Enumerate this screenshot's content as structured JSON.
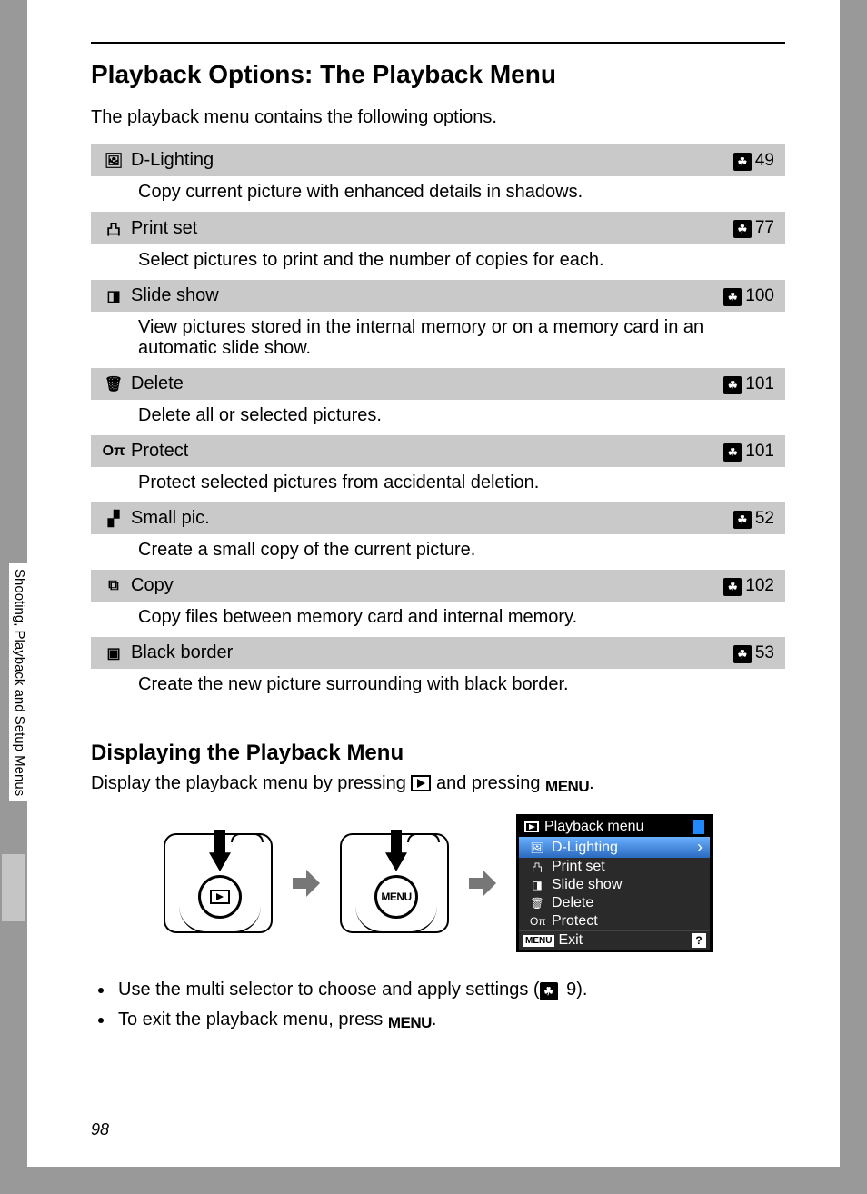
{
  "title": "Playback Options: The Playback Menu",
  "intro": "The playback menu contains the following options.",
  "sideTab": "Shooting, Playback and Setup Menus",
  "pageNumber": "98",
  "options": [
    {
      "icon": "🖼",
      "name": "D-Lighting",
      "page": "49",
      "desc": "Copy current picture with enhanced details in shadows."
    },
    {
      "icon": "凸",
      "name": "Print set",
      "page": "77",
      "desc": "Select pictures to print and the number of copies for each."
    },
    {
      "icon": "◨",
      "name": "Slide show",
      "page": "100",
      "desc": "View pictures stored in the internal memory or on a memory card in an automatic slide show."
    },
    {
      "icon": "🗑",
      "name": "Delete",
      "page": "101",
      "desc": "Delete all or selected pictures."
    },
    {
      "icon": "Oπ",
      "name": "Protect",
      "page": "101",
      "desc": "Protect selected pictures from accidental deletion."
    },
    {
      "icon": "▞",
      "name": "Small pic.",
      "page": "52",
      "desc": "Create a small copy of the current picture."
    },
    {
      "icon": "⧉",
      "name": "Copy",
      "page": "102",
      "desc": "Copy files between memory card and internal memory."
    },
    {
      "icon": "▣",
      "name": "Black border",
      "page": "53",
      "desc": "Create the new picture surrounding with black border."
    }
  ],
  "sub": {
    "heading": "Displaying the Playback Menu",
    "text_before": "Display the playback menu by pressing ",
    "text_mid": " and pressing ",
    "text_after": ".",
    "menu_word": "MENU"
  },
  "lcd": {
    "header": "Playback menu",
    "items": [
      "D-Lighting",
      "Print set",
      "Slide show",
      "Delete",
      "Protect"
    ],
    "footer_menu": "MENU",
    "footer_exit": "Exit",
    "help": "?"
  },
  "notes": {
    "n1a": "Use the multi selector to choose and apply settings (",
    "n1b": " 9).",
    "n2a": "To exit the playback menu, press ",
    "n2b": "."
  }
}
